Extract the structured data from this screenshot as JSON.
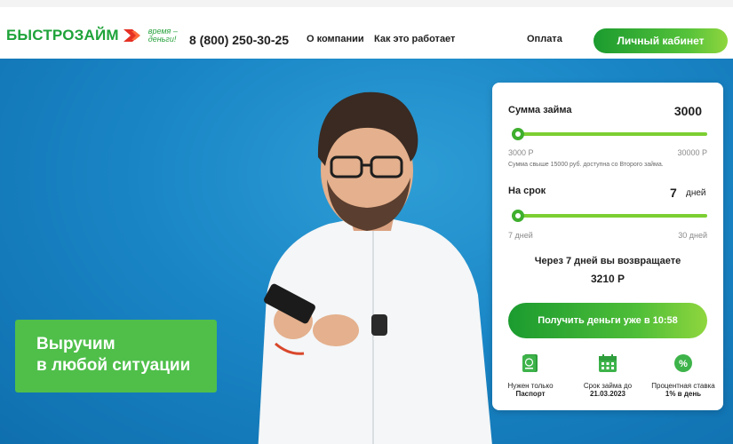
{
  "header": {
    "logo_text": "БЫСТРОЗАЙМ",
    "logo_slogan_line1": "время –",
    "logo_slogan_line2": "деньги!",
    "phone": "8 (800) 250-30-25",
    "nav": {
      "about": "О компании",
      "how": "Как это работает",
      "payment": "Оплата"
    },
    "cabinet_button": "Личный кабинет"
  },
  "hero": {
    "promo_line1": "Выручим",
    "promo_line2": "в любой ситуации"
  },
  "calculator": {
    "amount_label": "Сумма займа",
    "amount_value": "3000",
    "amount_min": "3000 Р",
    "amount_max": "30000 Р",
    "amount_fraction": 0.0,
    "amount_hint": "Сумма свыше 15000 руб. доступна со Второго займа.",
    "term_label": "На срок",
    "term_value": "7",
    "term_unit": "дней",
    "term_min": "7 дней",
    "term_max": "30 дней",
    "term_fraction": 0.0,
    "result_text": "Через 7 дней вы возвращаете",
    "result_sum": "3210 Р",
    "get_button": "Получить деньги уже в 10:58",
    "features": [
      {
        "icon": "passport-icon",
        "title": "Нужен только",
        "value": "Паспорт"
      },
      {
        "icon": "calendar-icon",
        "title": "Срок займа до",
        "value": "21.03.2023"
      },
      {
        "icon": "percent-icon",
        "title": "Процентная ставка",
        "value": "1% в день"
      }
    ]
  },
  "colors": {
    "brand_green": "#1fa33a",
    "hero_blue": "#1a86c6",
    "promo_green": "#4fbf4a",
    "accent_red": "#e53124"
  }
}
